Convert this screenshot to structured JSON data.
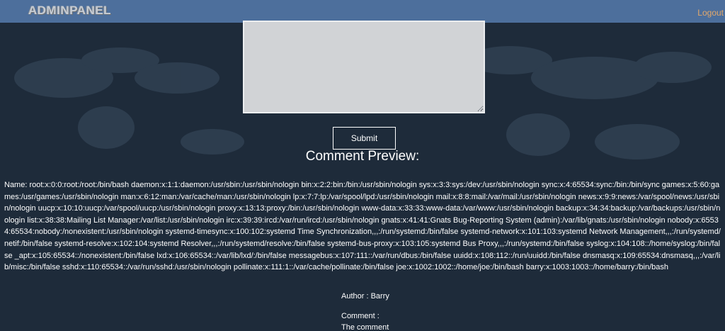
{
  "navbar": {
    "brand": "ADMINPANEL",
    "logout_label": "Logout"
  },
  "form": {
    "textarea_value": "",
    "submit_label": "Submit"
  },
  "preview": {
    "heading": "Comment Preview:",
    "name_text": "Name: root:x:0:0:root:/root:/bin/bash daemon:x:1:1:daemon:/usr/sbin:/usr/sbin/nologin bin:x:2:2:bin:/bin:/usr/sbin/nologin sys:x:3:3:sys:/dev:/usr/sbin/nologin sync:x:4:65534:sync:/bin:/bin/sync games:x:5:60:games:/usr/games:/usr/sbin/nologin man:x:6:12:man:/var/cache/man:/usr/sbin/nologin lp:x:7:7:lp:/var/spool/lpd:/usr/sbin/nologin mail:x:8:8:mail:/var/mail:/usr/sbin/nologin news:x:9:9:news:/var/spool/news:/usr/sbin/nologin uucp:x:10:10:uucp:/var/spool/uucp:/usr/sbin/nologin proxy:x:13:13:proxy:/bin:/usr/sbin/nologin www-data:x:33:33:www-data:/var/www:/usr/sbin/nologin backup:x:34:34:backup:/var/backups:/usr/sbin/nologin list:x:38:38:Mailing List Manager:/var/list:/usr/sbin/nologin irc:x:39:39:ircd:/var/run/ircd:/usr/sbin/nologin gnats:x:41:41:Gnats Bug-Reporting System (admin):/var/lib/gnats:/usr/sbin/nologin nobody:x:65534:65534:nobody:/nonexistent:/usr/sbin/nologin systemd-timesync:x:100:102:systemd Time Synchronization,,,:/run/systemd:/bin/false systemd-network:x:101:103:systemd Network Management,,,:/run/systemd/netif:/bin/false systemd-resolve:x:102:104:systemd Resolver,,,:/run/systemd/resolve:/bin/false systemd-bus-proxy:x:103:105:systemd Bus Proxy,,,:/run/systemd:/bin/false syslog:x:104:108::/home/syslog:/bin/false _apt:x:105:65534::/nonexistent:/bin/false lxd:x:106:65534::/var/lib/lxd/:/bin/false messagebus:x:107:111::/var/run/dbus:/bin/false uuidd:x:108:112::/run/uuidd:/bin/false dnsmasq:x:109:65534:dnsmasq,,,:/var/lib/misc:/bin/false sshd:x:110:65534::/var/run/sshd:/usr/sbin/nologin pollinate:x:111:1::/var/cache/pollinate:/bin/false joe:x:1002:1002::/home/joe:/bin/bash barry:x:1003:1003::/home/barry:/bin/bash",
    "author": "Author : Barry",
    "comment_label": "Comment :",
    "comment_text": "The comment"
  },
  "colors": {
    "page_background": "#1e2b3a",
    "navbar_background": "#4d6f9c",
    "logout_link": "#e3a86b"
  }
}
